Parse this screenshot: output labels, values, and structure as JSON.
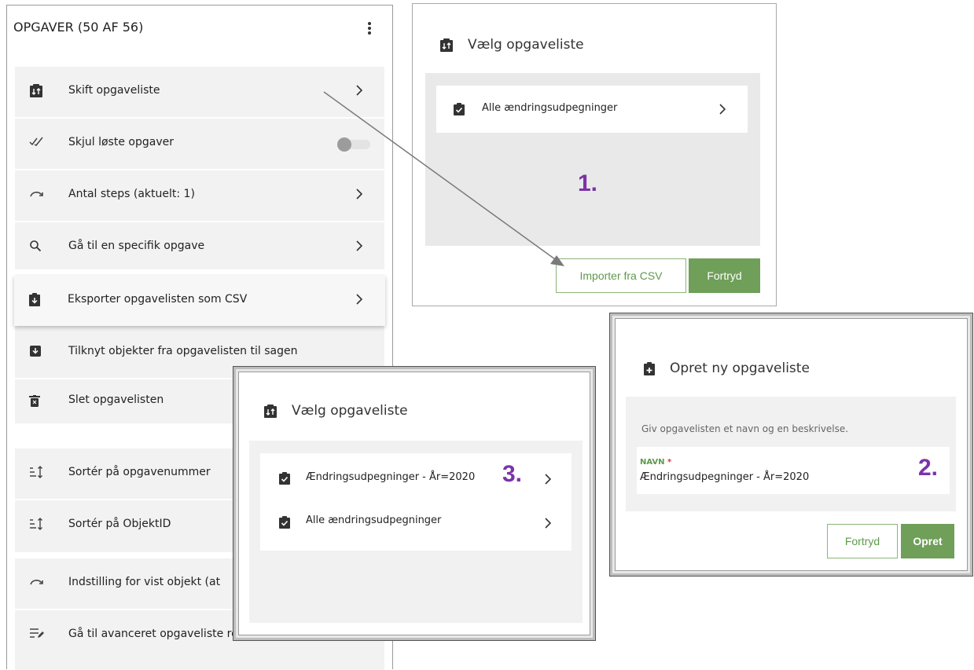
{
  "tasks_panel": {
    "title": "OPGAVER (50 AF 56)",
    "items": {
      "switch": "Skift opgaveliste",
      "hide_solved": "Skjul løste opgaver",
      "steps": "Antal steps (aktuelt: 1)",
      "goto": "Gå til en specifik opgave",
      "export": "Eksporter opgavelisten som CSV",
      "attach": "Tilknyt objekter fra opgavelisten til sagen",
      "delete": "Slet opgavelisten",
      "sort_task": "Sortér på opgavenummer",
      "sort_object": "Sortér på ObjektID",
      "shown_object": "Indstilling for vist objekt (at",
      "advanced": "Gå til avanceret opgaveliste redigering"
    },
    "hide_solved_enabled": false
  },
  "dialog_choose_1": {
    "title": "Vælg opgaveliste",
    "items": [
      "Alle ændringsudpegninger"
    ],
    "step_label": "1.",
    "import_label": "Importer fra CSV",
    "cancel_label": "Fortryd"
  },
  "dialog_create": {
    "title": "Opret ny opgaveliste",
    "instruction": "Giv opgavelisten et navn og en beskrivelse.",
    "name_label": "NAVN",
    "required_mark": "*",
    "name_value": "Ændringsudpegninger - År=2020",
    "step_label": "2.",
    "cancel_label": "Fortryd",
    "create_label": "Opret"
  },
  "dialog_choose_3": {
    "title": "Vælg opgaveliste",
    "items": [
      "Ændringsudpegninger - År=2020",
      "Alle ændringsudpegninger"
    ],
    "step_label": "3."
  },
  "colors": {
    "accent_green": "#6f9f59",
    "step_purple": "#7a33a9",
    "panel_gray": "#f2f2f2"
  }
}
